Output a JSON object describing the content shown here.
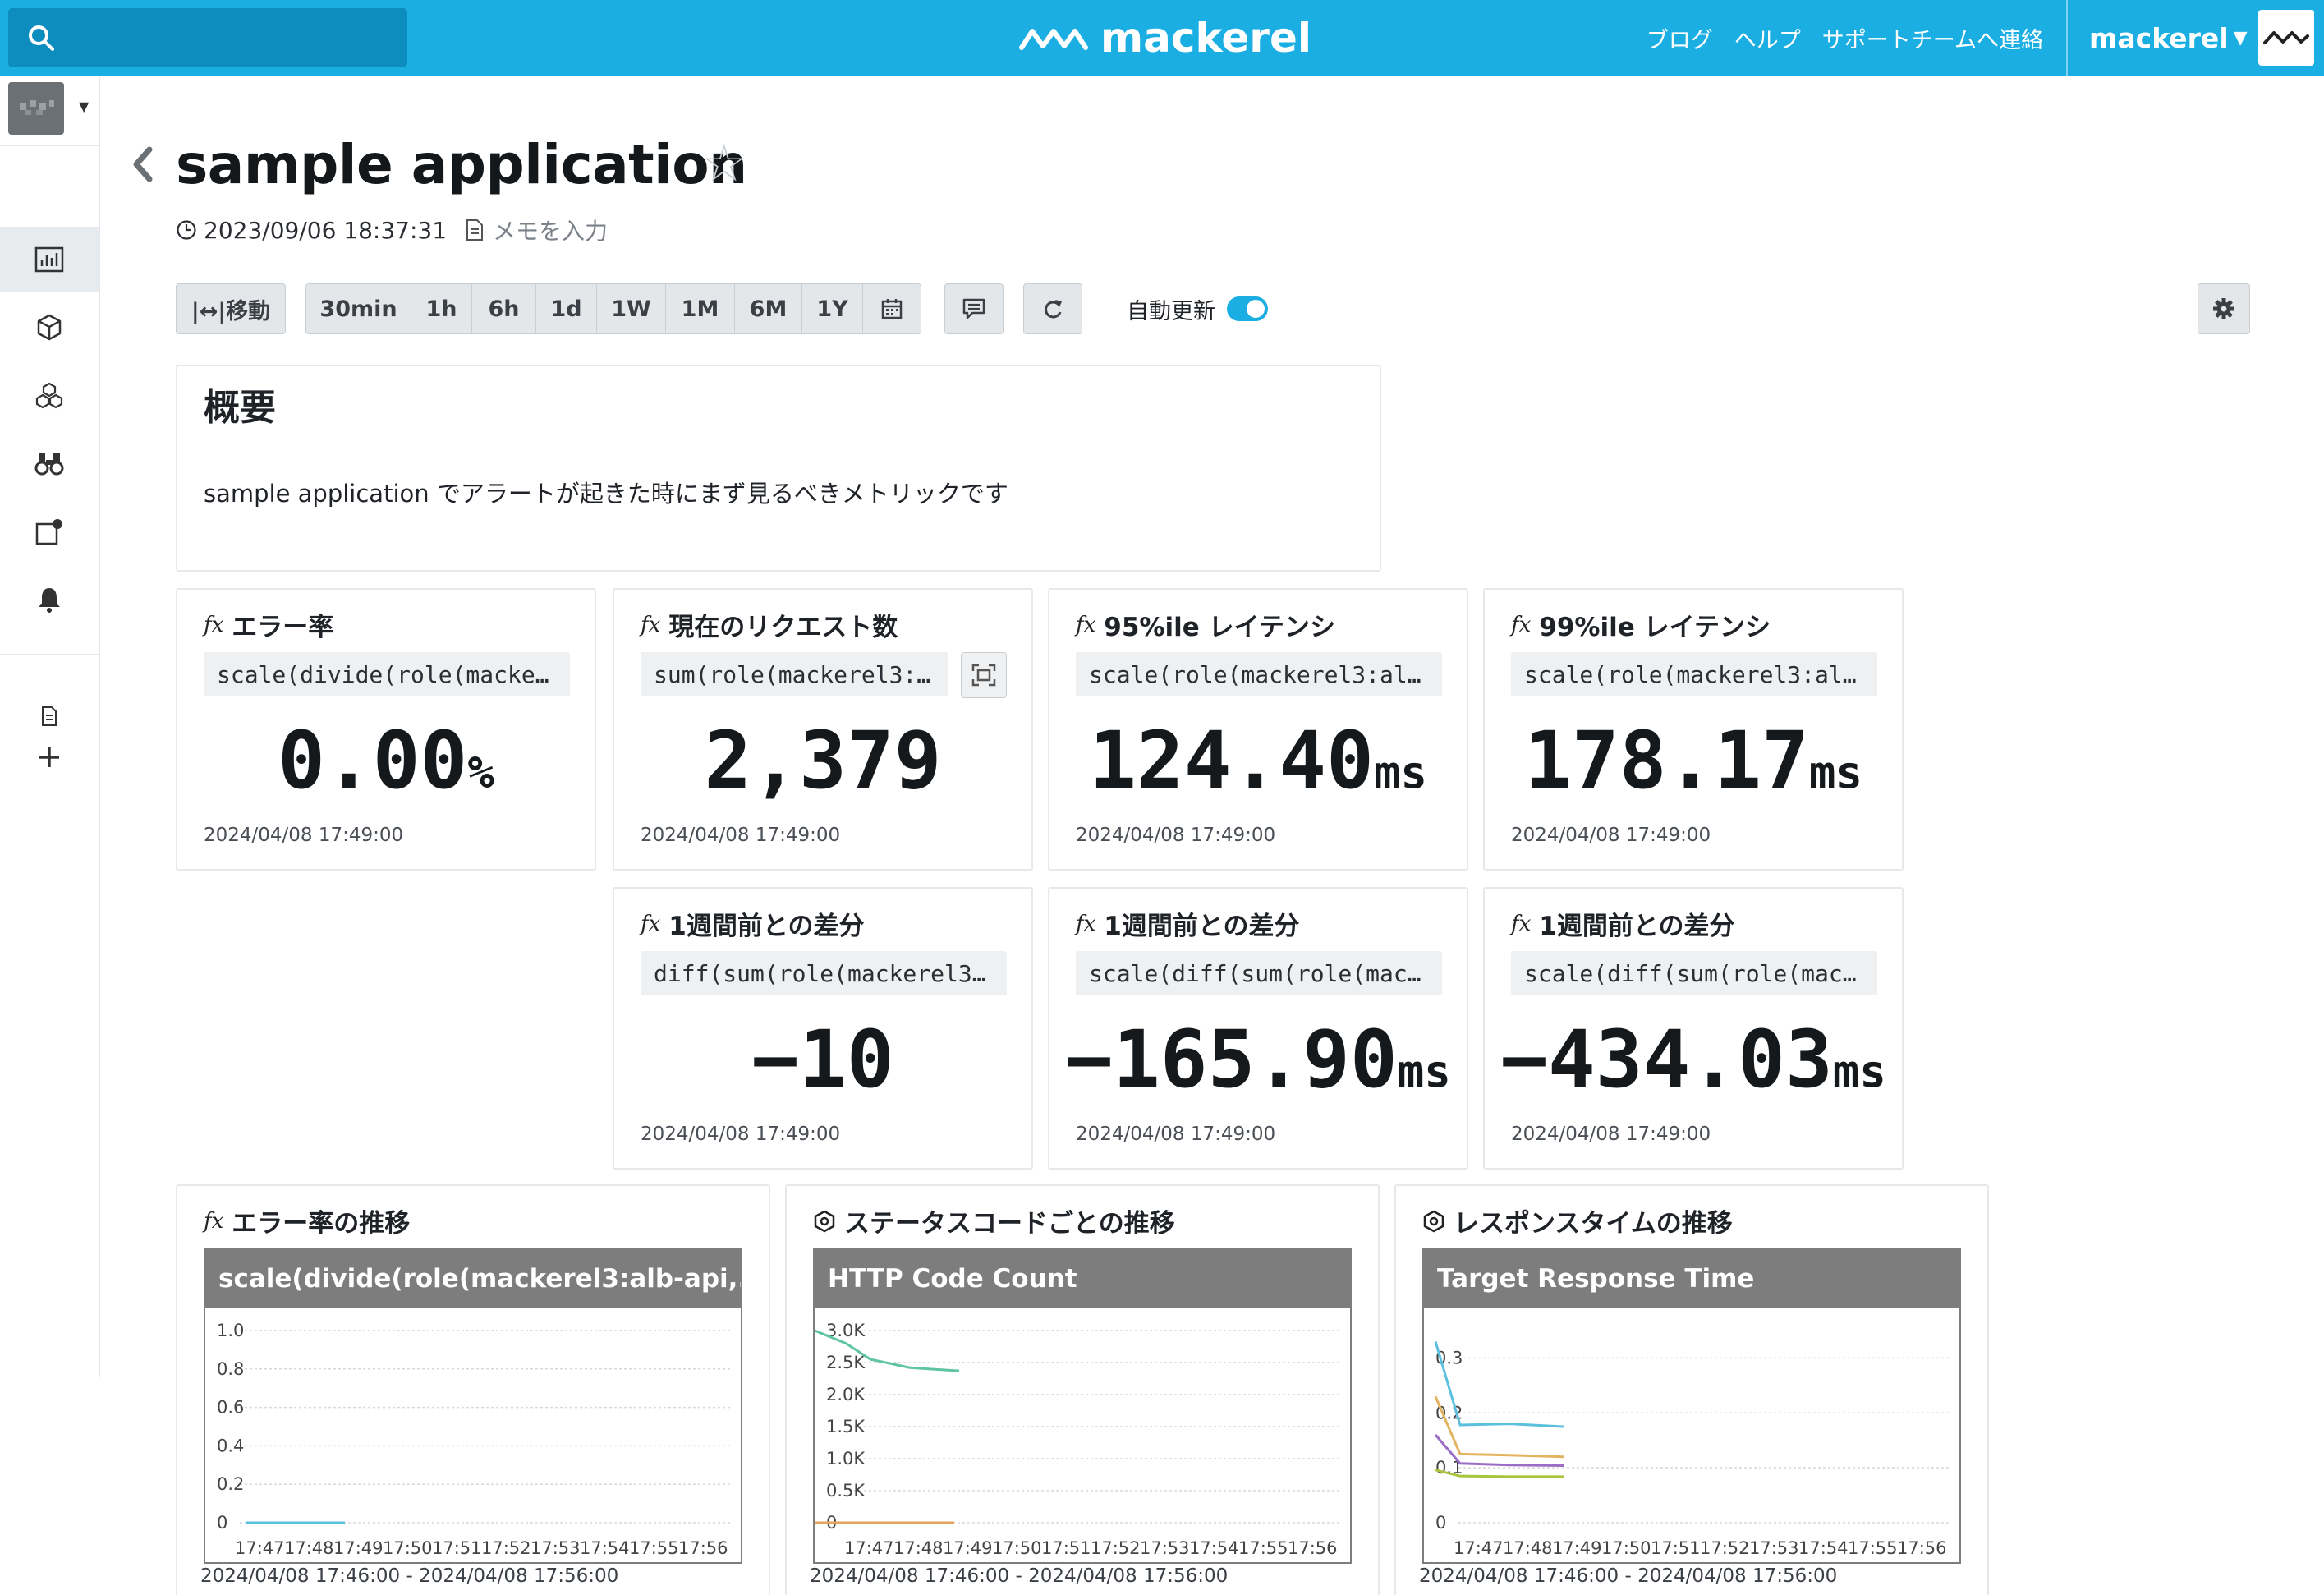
{
  "header": {
    "search_placeholder": "",
    "logo_text": "mackerel",
    "links": [
      "ブログ",
      "ヘルプ",
      "サポートチームへ連絡"
    ],
    "org_name": "mackerel",
    "brand_color": "#1aaee3"
  },
  "sidebar": {
    "items": [
      {
        "icon": "dashboard-icon",
        "active": true
      },
      {
        "icon": "hosts-icon",
        "active": false
      },
      {
        "icon": "services-icon",
        "active": false
      },
      {
        "icon": "monitors-icon",
        "active": false
      },
      {
        "icon": "overview-icon",
        "active": false
      },
      {
        "icon": "alerts-icon",
        "active": false
      }
    ],
    "extra": [
      {
        "icon": "document-icon"
      },
      {
        "icon": "add-icon"
      }
    ]
  },
  "page": {
    "title": "sample application",
    "timestamp": "2023/09/06 18:37:31",
    "memo_placeholder": "メモを入力"
  },
  "toolbar": {
    "move_label": "|↔|移動",
    "ranges": [
      "30min",
      "1h",
      "6h",
      "1d",
      "1W",
      "1M",
      "6M",
      "1Y"
    ],
    "auto_refresh_label": "自動更新",
    "auto_refresh_on": true
  },
  "overview": {
    "title": "概要",
    "text": "sample application でアラートが起きた時にまず見るべきメトリックです"
  },
  "value_widgets": [
    {
      "title": "エラー率",
      "expr": "scale(divide(role(mackerel3:alb-api,...",
      "value": "0.00",
      "unit": "%",
      "time": "2024/04/08 17:49:00"
    },
    {
      "title": "現在のリクエスト数",
      "expr": "sum(role(mackerel3:alb-api,...",
      "value": "2,379",
      "unit": "",
      "time": "2024/04/08 17:49:00"
    },
    {
      "title": "95%ile レイテンシ",
      "expr": "scale(role(mackerel3:alb-api,...",
      "value": "124.40",
      "unit": "ms",
      "time": "2024/04/08 17:49:00"
    },
    {
      "title": "99%ile レイテンシ",
      "expr": "scale(role(mackerel3:alb-api,...",
      "value": "178.17",
      "unit": "ms",
      "time": "2024/04/08 17:49:00"
    },
    {
      "title": "1週間前との差分",
      "expr": "diff(sum(role(mackerel3:alb-api,...",
      "value": "−10",
      "unit": "",
      "time": "2024/04/08 17:49:00"
    },
    {
      "title": "1週間前との差分",
      "expr": "scale(diff(sum(role(mackerel3:alb-api,...",
      "value": "−165.90",
      "unit": "ms",
      "time": "2024/04/08 17:49:00"
    },
    {
      "title": "1週間前との差分",
      "expr": "scale(diff(sum(role(mackerel3:alb-api,...",
      "value": "−434.03",
      "unit": "ms",
      "time": "2024/04/08 17:49:00"
    }
  ],
  "graph_widgets": [
    {
      "title": "エラー率の推移",
      "icon": "fx",
      "graph_title": "scale(divide(role(mackerel3:alb-api,...",
      "range": "2024/04/08 17:46:00 - 2024/04/08 17:56:00"
    },
    {
      "title": "ステータスコードごとの推移",
      "icon": "hexagon-icon",
      "graph_title": "HTTP Code Count",
      "range": "2024/04/08 17:46:00 - 2024/04/08 17:56:00"
    },
    {
      "title": "レスポンスタイムの推移",
      "icon": "hexagon-icon",
      "graph_title": "Target Response Time",
      "range": "2024/04/08 17:46:00 - 2024/04/08 17:56:00"
    }
  ],
  "chart_data": [
    {
      "type": "line",
      "x": [
        "17:47",
        "17:48",
        "17:49",
        "17:50",
        "17:51",
        "17:52",
        "17:53",
        "17:54",
        "17:55",
        "17:56"
      ],
      "ylim": [
        0,
        1.0
      ],
      "yticks": [
        "1.0",
        "0.8",
        "0.6",
        "0.4",
        "0.2",
        "0"
      ],
      "series": [
        {
          "color": "#5bc0de",
          "points": [
            [
              0,
              0
            ],
            [
              1,
              0
            ],
            [
              2,
              0
            ]
          ]
        }
      ]
    },
    {
      "type": "line",
      "x": [
        "17:47",
        "17:48",
        "17:49",
        "17:50",
        "17:51",
        "17:52",
        "17:53",
        "17:54",
        "17:55",
        "17:56"
      ],
      "ylim": [
        0,
        3000
      ],
      "yticks": [
        "3.0K",
        "2.5K",
        "2.0K",
        "1.5K",
        "1.0K",
        "0.5K",
        "0"
      ],
      "series": [
        {
          "color": "#5fc3a5",
          "points": [
            [
              -0.9,
              3000
            ],
            [
              -0.2,
              2800
            ],
            [
              0.3,
              2550
            ],
            [
              1.1,
              2420
            ],
            [
              2.1,
              2370
            ]
          ]
        },
        {
          "color": "#e3a35f",
          "points": [
            [
              -0.9,
              0
            ],
            [
              0,
              0
            ],
            [
              1,
              0
            ],
            [
              2,
              0
            ]
          ]
        }
      ]
    },
    {
      "type": "line",
      "x": [
        "17:47",
        "17:48",
        "17:49",
        "17:50",
        "17:51",
        "17:52",
        "17:53",
        "17:54",
        "17:55",
        "17:56"
      ],
      "ylim": [
        0,
        0.35
      ],
      "yticks": [
        "0.3",
        "0.2",
        "0.1",
        "0"
      ],
      "series": [
        {
          "color": "#5bc0de",
          "points": [
            [
              -0.6,
              0.33
            ],
            [
              -0.1,
              0.178
            ],
            [
              0.9,
              0.18
            ],
            [
              2.0,
              0.175
            ]
          ]
        },
        {
          "color": "#e3b45f",
          "points": [
            [
              -0.6,
              0.23
            ],
            [
              -0.1,
              0.125
            ],
            [
              0.9,
              0.123
            ],
            [
              2.0,
              0.12
            ]
          ]
        },
        {
          "color": "#9b6dc6",
          "points": [
            [
              -0.6,
              0.16
            ],
            [
              -0.1,
              0.108
            ],
            [
              0.9,
              0.105
            ],
            [
              2.0,
              0.104
            ]
          ]
        },
        {
          "color": "#a8c43c",
          "points": [
            [
              -0.6,
              0.096
            ],
            [
              -0.1,
              0.085
            ],
            [
              0.9,
              0.084
            ],
            [
              2.0,
              0.084
            ]
          ]
        }
      ]
    }
  ]
}
